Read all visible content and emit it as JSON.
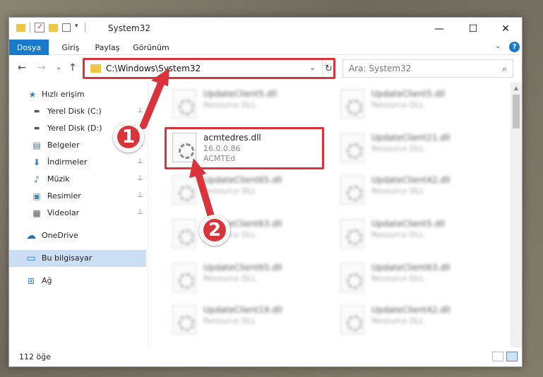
{
  "window": {
    "title": "System32",
    "minimize_glyph": "—",
    "maximize_glyph": "☐",
    "close_glyph": "✕"
  },
  "ribbon": {
    "tabs": [
      "Dosya",
      "Giriş",
      "Paylaş",
      "Görünüm"
    ],
    "chevron": "⌄",
    "help": "?"
  },
  "nav": {
    "back": "←",
    "forward": "→",
    "recent": "⌄",
    "up": "↑",
    "address": "C:\\Windows\\System32",
    "address_dropdown": "⌄",
    "refresh": "↻",
    "search_placeholder": "Ara: System32",
    "search_glyph": "⌕"
  },
  "sidebar": {
    "items": [
      {
        "label": "Hızlı erişim",
        "icon": "star-icon",
        "glyph": "★",
        "color": "#2a7fd4",
        "pinned": false
      },
      {
        "label": "Yerel Disk (C:)",
        "icon": "drive-icon",
        "glyph": "▬",
        "color": "#555",
        "pinned": true
      },
      {
        "label": "Yerel Disk (D:)",
        "icon": "drive-icon",
        "glyph": "▬",
        "color": "#555",
        "pinned": true
      },
      {
        "label": "Belgeler",
        "icon": "documents-icon",
        "glyph": "▤",
        "color": "#4a6a8a",
        "pinned": true
      },
      {
        "label": "İndirmeler",
        "icon": "download-icon",
        "glyph": "⬇",
        "color": "#2a7fd4",
        "pinned": true
      },
      {
        "label": "Müzik",
        "icon": "music-icon",
        "glyph": "♪",
        "color": "#2a7fd4",
        "pinned": true
      },
      {
        "label": "Resimler",
        "icon": "pictures-icon",
        "glyph": "▣",
        "color": "#4a8ab0",
        "pinned": true
      },
      {
        "label": "Videolar",
        "icon": "videos-icon",
        "glyph": "▦",
        "color": "#555",
        "pinned": true
      },
      {
        "label": "OneDrive",
        "icon": "cloud-icon",
        "glyph": "☁",
        "color": "#1a6fc4",
        "pinned": false
      },
      {
        "label": "Bu bilgisayar",
        "icon": "computer-icon",
        "glyph": "▭",
        "color": "#2a7fd4",
        "pinned": false
      },
      {
        "label": "Ağ",
        "icon": "network-icon",
        "glyph": "⊞",
        "color": "#2a7fd4",
        "pinned": false
      }
    ],
    "pin_glyph": "📌"
  },
  "files": {
    "left_column": [
      {
        "name": "UpdateClient5.dll",
        "line2": "Resource DLL",
        "line3": ""
      },
      {
        "name": "acmtedres.dll",
        "line2": "16.0.0.86",
        "line3": "ACMTEd"
      },
      {
        "name": "UpdateClient65.dll",
        "line2": "Resource DLL",
        "line3": ""
      },
      {
        "name": "UpdateClient63.dll",
        "line2": "Resource DLL",
        "line3": ""
      },
      {
        "name": "UpdateClient65.dll",
        "line2": "Resource DLL",
        "line3": ""
      },
      {
        "name": "UpdateClient19.dll",
        "line2": "Resource DLL",
        "line3": ""
      }
    ],
    "right_column": [
      {
        "name": "UpdateClient5.dll",
        "line2": "Resource DLL"
      },
      {
        "name": "UpdateClient21.dll",
        "line2": "Resource DLL"
      },
      {
        "name": "UpdateClient42.dll",
        "line2": "Resource DLL"
      },
      {
        "name": "UpdateClient5.dll",
        "line2": "Resource DLL"
      },
      {
        "name": "UpdateClient63.dll",
        "line2": "Resource DLL"
      },
      {
        "name": "UpdateClient42.dll",
        "line2": "Resource DLL"
      }
    ]
  },
  "status": {
    "count": "112 öğe"
  },
  "annotations": {
    "step1": "1",
    "step2": "2",
    "color": "#d9343b"
  }
}
